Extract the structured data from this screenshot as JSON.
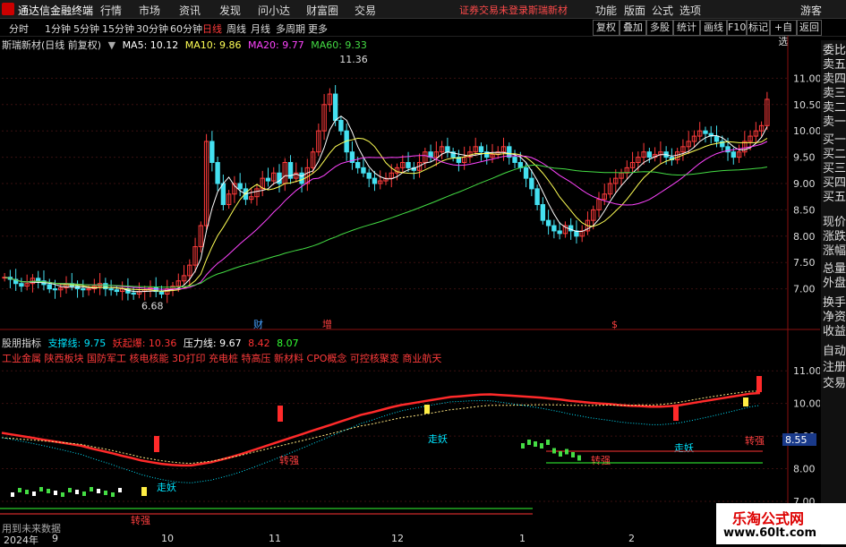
{
  "app": {
    "title": "通达信金融终端",
    "warning": "证券交易未登录",
    "stock": "斯瑞新材"
  },
  "menu": [
    "行情",
    "市场",
    "资讯",
    "发现",
    "问小达",
    "财富圈",
    "交易"
  ],
  "top_right": [
    "功能",
    "版面",
    "公式",
    "选项",
    "游客"
  ],
  "periods": [
    "分时",
    "1分钟",
    "5分钟",
    "15分钟",
    "30分钟",
    "60分钟",
    "日线",
    "周线",
    "月线",
    "多周期",
    "更多"
  ],
  "active_period": "日线",
  "toolbar_right": [
    "复权",
    "叠加",
    "多股",
    "统计",
    "画线",
    "F10",
    "标记",
    "+自选",
    "返回"
  ],
  "header": {
    "title": "斯瑞新材(日线 前复权)",
    "ma": [
      {
        "label": "MA5: 10.12",
        "color": "#ffffff"
      },
      {
        "label": "MA10: 9.86",
        "color": "#ffff55"
      },
      {
        "label": "MA20: 9.77",
        "color": "#ff44ff"
      },
      {
        "label": "MA60: 9.33",
        "color": "#44dd44"
      }
    ]
  },
  "right_panel": [
    "委比",
    "卖五",
    "卖四",
    "卖三",
    "卖二",
    "卖一",
    "买一",
    "买二",
    "买三",
    "买四",
    "买五",
    "现价",
    "涨跌",
    "涨幅",
    "总量",
    "外盘",
    "换手",
    "净资",
    "收益",
    "自动",
    "注册",
    "交易"
  ],
  "chart_data": [
    {
      "type": "candlestick",
      "title": "斯瑞新材(日线 前复权)",
      "ylim": [
        6.5,
        11.5
      ],
      "yticks": [
        "11.00",
        "10.50",
        "10.00",
        "9.50",
        "9.00",
        "8.50",
        "8.00",
        "7.50",
        "7.00"
      ],
      "annotations": [
        {
          "label": "11.36",
          "value": 11.36
        },
        {
          "label": "6.68",
          "value": 6.68
        }
      ],
      "markers": [
        "财",
        "增",
        "$"
      ],
      "close": [
        7.22,
        7.18,
        7.1,
        7.05,
        7.1,
        7.2,
        7.15,
        7.08,
        7.0,
        6.98,
        7.02,
        7.1,
        7.05,
        7.0,
        6.98,
        7.0,
        7.05,
        7.1,
        7.0,
        6.98,
        6.95,
        7.0,
        6.92,
        6.9,
        6.95,
        6.98,
        7.02,
        6.95,
        6.9,
        7.0,
        7.05,
        7.15,
        7.25,
        7.45,
        7.8,
        8.2,
        9.8,
        9.4,
        9.0,
        8.6,
        8.8,
        9.0,
        8.9,
        8.7,
        8.75,
        8.9,
        9.1,
        9.05,
        9.2,
        9.0,
        9.4,
        9.1,
        9.2,
        9.0,
        9.3,
        9.6,
        10.0,
        10.5,
        10.7,
        10.2,
        10.0,
        9.6,
        9.4,
        9.3,
        9.2,
        9.1,
        9.0,
        9.05,
        9.1,
        9.2,
        9.3,
        9.4,
        9.3,
        9.25,
        9.4,
        9.6,
        9.5,
        9.6,
        9.7,
        9.6,
        9.5,
        9.4,
        9.5,
        9.6,
        9.7,
        9.6,
        9.5,
        9.55,
        9.6,
        9.7,
        9.5,
        9.4,
        9.3,
        9.1,
        8.9,
        8.6,
        8.3,
        8.2,
        8.1,
        8.05,
        8.2,
        8.1,
        8.0,
        8.1,
        8.3,
        8.5,
        8.7,
        8.8,
        9.0,
        9.1,
        9.2,
        9.3,
        9.4,
        9.5,
        9.6,
        9.5,
        9.55,
        9.6,
        9.5,
        9.45,
        9.6,
        9.7,
        9.8,
        9.9,
        10.0,
        9.95,
        9.9,
        9.8,
        9.7,
        9.6,
        9.5,
        9.6,
        9.8,
        9.9,
        10.0,
        10.1,
        10.6
      ],
      "ma_series": [
        "MA5",
        "MA10",
        "MA20",
        "MA60"
      ]
    },
    {
      "type": "line",
      "title": "股朋指标",
      "legend": [
        {
          "label": "支撑线: 9.75",
          "color": "#00e5ff"
        },
        {
          "label": "妖起爆: 10.36",
          "color": "#ff3333"
        },
        {
          "label": "压力线: 9.67",
          "color": "#ffffff"
        },
        {
          "label": "8.42",
          "color": "#ff3333"
        },
        {
          "label": "8.07",
          "color": "#33ff33"
        }
      ],
      "concepts": "工业金属 陕西板块 国防军工 核电核能 3D打印 充电桩 特高压 新材料 CPO概念 可控核聚变 商业航天",
      "ylim": [
        7.0,
        11.5
      ],
      "yticks": [
        "11.00",
        "10.00",
        "9.00",
        "8.00",
        "7.00"
      ],
      "price_label": "8.55",
      "labels": [
        "走妖",
        "转强",
        "走妖",
        "转强",
        "转强",
        "走妖",
        "转强"
      ],
      "red_line": [
        9.1,
        9.05,
        9.0,
        8.95,
        8.9,
        8.85,
        8.8,
        8.75,
        8.7,
        8.62,
        8.55,
        8.48,
        8.4,
        8.33,
        8.25,
        8.2,
        8.15,
        8.12,
        8.1,
        8.1,
        8.15,
        8.2,
        8.28,
        8.36,
        8.45,
        8.55,
        8.65,
        8.75,
        8.85,
        8.95,
        9.05,
        9.15,
        9.25,
        9.35,
        9.45,
        9.55,
        9.65,
        9.72,
        9.8,
        9.88,
        9.95,
        10.0,
        10.05,
        10.1,
        10.15,
        10.2,
        10.22,
        10.25,
        10.27,
        10.28,
        10.26,
        10.24,
        10.22,
        10.2,
        10.18,
        10.15,
        10.12,
        10.08,
        10.05,
        10.02,
        10.0,
        9.98,
        9.95,
        9.93,
        9.92,
        9.9,
        9.9,
        9.92,
        9.95,
        10.0,
        10.05,
        10.1,
        10.15,
        10.2,
        10.25,
        10.3,
        10.32
      ]
    }
  ],
  "xaxis": [
    "2024年",
    "9",
    "10",
    "11",
    "12",
    "1",
    "2"
  ],
  "footer": {
    "future": "用到未来数据"
  },
  "watermark": {
    "line1": "乐淘公式网",
    "line2": "www.60lt.com"
  }
}
